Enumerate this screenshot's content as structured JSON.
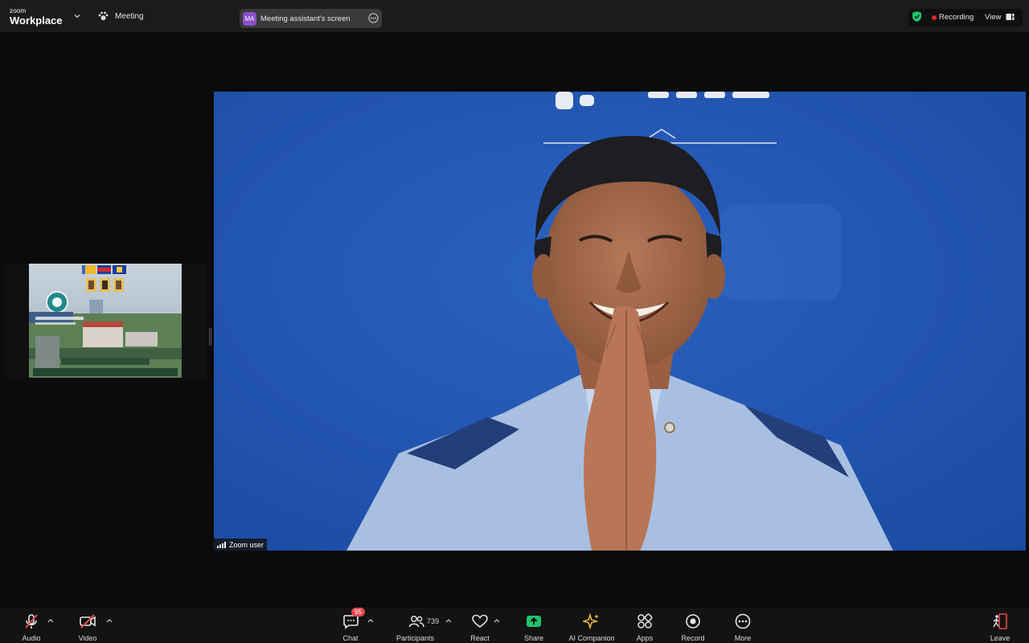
{
  "app": {
    "logo_top": "zoom",
    "logo_bottom": "Workplace",
    "meeting_label": "Meeting"
  },
  "screen_share": {
    "avatar_initials": "MA",
    "label": "Meeting assistant's screen"
  },
  "status": {
    "recording_label": "Recording",
    "view_label": "View"
  },
  "main_video": {
    "participant_name": "Zoom user"
  },
  "toolbar": {
    "audio": "Audio",
    "video": "Video",
    "chat": "Chat",
    "chat_badge": "95",
    "participants": "Participants",
    "participants_count": "739",
    "react": "React",
    "share": "Share",
    "ai_companion": "AI Companion",
    "apps": "Apps",
    "record": "Record",
    "more": "More",
    "leave": "Leave"
  },
  "colors": {
    "accent_green": "#1fc46b",
    "recording_red": "#e2262b",
    "leave_red": "#e5484d",
    "ai_gold": "#f3c54a",
    "video_blue": "#1e4fa8"
  },
  "icons": {
    "meeting": "paw-icon",
    "share_more": "ellipsis-icon",
    "security": "shield-check-icon",
    "audio": "mic-muted-icon",
    "video": "camera-off-icon",
    "chat": "chat-bubble-icon",
    "participants": "people-icon",
    "react": "heart-icon",
    "share": "share-arrow-icon",
    "ai_companion": "sparkle-icon",
    "apps": "apps-icon",
    "record": "record-icon",
    "more": "more-dots-icon",
    "leave": "leave-door-icon"
  }
}
